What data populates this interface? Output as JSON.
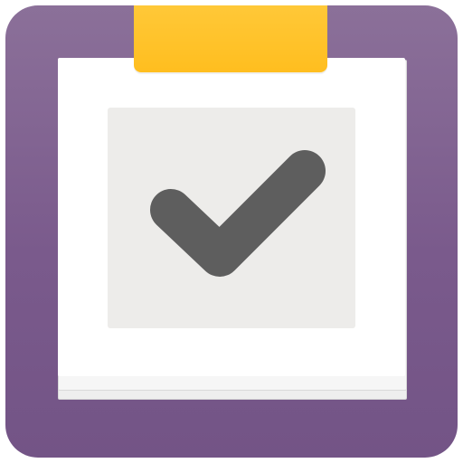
{
  "icon": {
    "name": "clipboard-checklist-app-icon",
    "colors": {
      "frame": "#7a5a8c",
      "clip": "#ffc12a",
      "paper": "#ffffff",
      "panel": "#edecea",
      "check": "#5e5e5e"
    },
    "glyph": "checkmark-icon"
  }
}
